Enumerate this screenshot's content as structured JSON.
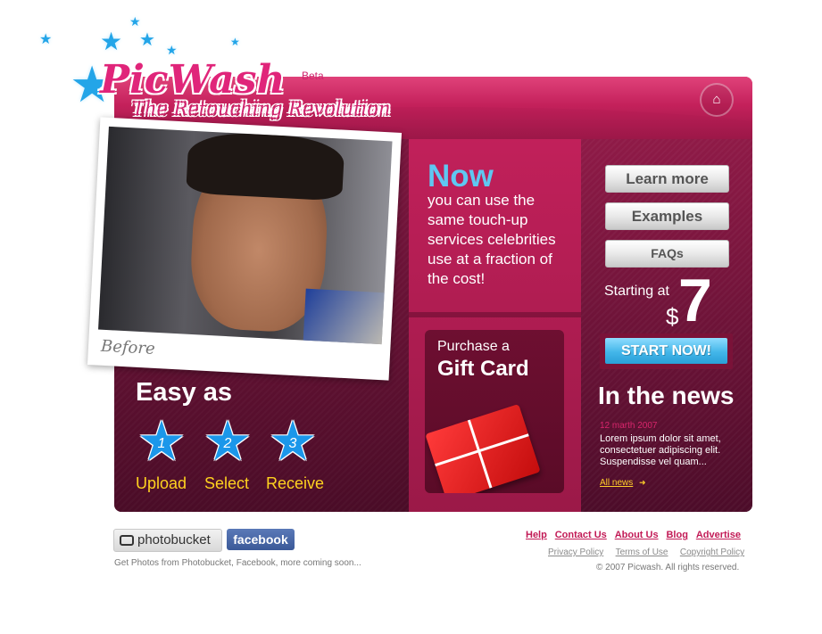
{
  "brand": {
    "name": "PicWash",
    "badge": "Beta",
    "tagline": "The Retouching Revolution"
  },
  "header": {
    "home_icon": "home-icon"
  },
  "photo": {
    "caption": "Before"
  },
  "steps": {
    "heading": "Easy as",
    "items": [
      {
        "number": "1",
        "label": "Upload"
      },
      {
        "number": "2",
        "label": "Select"
      },
      {
        "number": "3",
        "label": "Receive"
      }
    ]
  },
  "promo": {
    "headline": "Now",
    "body": "you can use the same touch-up services celebrities use at a fraction of the cost!"
  },
  "gift": {
    "line1": "Purchase a",
    "line2": "Gift Card"
  },
  "menu": {
    "learn_more": "Learn more",
    "examples": "Examples",
    "faqs": "FAQs"
  },
  "pricing": {
    "prefix": "Starting at",
    "currency": "$",
    "amount": "7",
    "cta": "START NOW!"
  },
  "news": {
    "heading": "In the news",
    "date": "12 marth 2007",
    "body": "Lorem ipsum dolor sit amet, consectetuer adipiscing elit. Suspendisse vel quam...",
    "link": "All news"
  },
  "footer": {
    "photobucket": "photobucket",
    "facebook": "facebook",
    "note": "Get Photos from Photobucket, Facebook, more coming soon...",
    "links": [
      "Help",
      "Contact Us",
      "About Us",
      "Blog",
      "Advertise"
    ],
    "secondary_links": [
      "Privacy Policy",
      "Terms of Use",
      "Copyright Policy"
    ],
    "copyright": "© 2007 Picwash. All rights reserved."
  },
  "colors": {
    "accent": "#c8225e",
    "sky": "#5fc7f1",
    "yellow": "#ffd21f"
  }
}
